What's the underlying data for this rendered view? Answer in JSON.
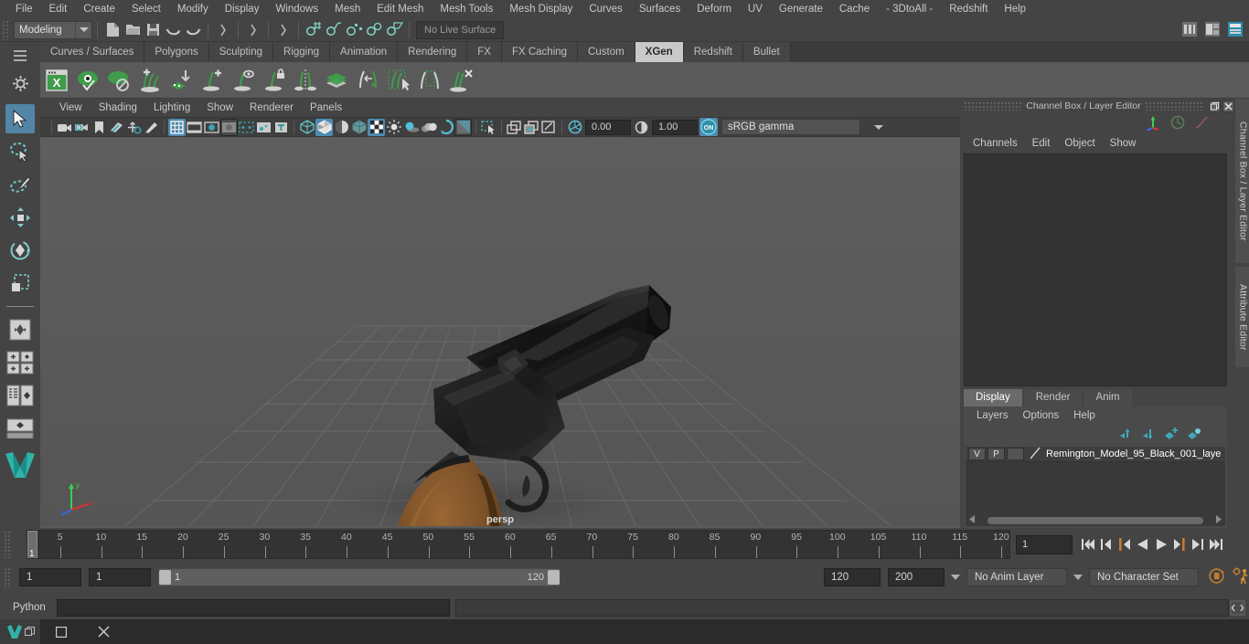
{
  "app": {
    "menubar": [
      "File",
      "Edit",
      "Create",
      "Select",
      "Modify",
      "Display",
      "Windows",
      "Mesh",
      "Edit Mesh",
      "Mesh Tools",
      "Mesh Display",
      "Curves",
      "Surfaces",
      "Deform",
      "UV",
      "Generate",
      "Cache",
      "- 3DtoAll -",
      "Redshift",
      "Help"
    ]
  },
  "statusline": {
    "mode": "Modeling",
    "live_surface": "No Live Surface"
  },
  "shelf": {
    "tabs": [
      "Curves / Surfaces",
      "Polygons",
      "Sculpting",
      "Rigging",
      "Animation",
      "Rendering",
      "FX",
      "FX Caching",
      "Custom",
      "XGen",
      "Redshift",
      "Bullet"
    ],
    "active_tab": "XGen",
    "icons": [
      "xgen-window-icon",
      "xgen-preview-icon",
      "xgen-disable-preview-icon",
      "xgen-create-description-icon",
      "xgen-import-collection-icon",
      "xgen-add-guide-icon",
      "xgen-select-guide-icon",
      "xgen-lock-guide-icon",
      "xgen-mirror-guide-icon",
      "xgen-density-mask-icon",
      "xgen-move-guide-icon",
      "xgen-guide-select-icon",
      "xgen-region-icon",
      "xgen-delete-guide-icon"
    ]
  },
  "toolbox": {
    "items": [
      "select-tool",
      "lasso-select-tool",
      "paint-select-tool",
      "move-tool",
      "rotate-tool",
      "scale-tool",
      "last-tool-used",
      "snap-grid-icon",
      "snap-curve-icon",
      "snap-point-icon",
      "snap-view-plane-icon",
      "outliner-layout-icon",
      "persp-layout-icon",
      "single-perspective-icon",
      "maya-logo-icon"
    ],
    "selected": "select-tool"
  },
  "viewport": {
    "menu": [
      "View",
      "Shading",
      "Lighting",
      "Show",
      "Renderer",
      "Panels"
    ],
    "toolbar": {
      "exposure": "0.00",
      "gamma_value": "1.00",
      "color_management": "sRGB gamma",
      "color_mgmt_toggle": "ON",
      "icons": [
        "select-camera-icon",
        "camera-attributes-icon",
        "bookmark-icon",
        "image-plane-icon",
        "two-d-pan-zoom-icon",
        "grease-pencil-icon",
        "grid-toggle-icon",
        "film-gate-icon",
        "resolution-gate-icon",
        "gate-mask-icon",
        "film-origin-icon",
        "exposure-icon",
        "safe-title-icon",
        "wireframe-icon",
        "smooth-shade-all-icon",
        "shaded-wireframe-icon",
        "textured-icon",
        "use-all-lights-icon",
        "shadows-icon",
        "screen-space-ao-icon",
        "motion-blur-icon",
        "multisample-icon",
        "depth-of-field-icon",
        "isolate-select-icon",
        "xray-icon",
        "xray-joints-icon",
        "xray-active-components-icon",
        "viewport-exposure-icon",
        "gamma-icon"
      ]
    },
    "camera_label": "persp",
    "scene_object": "Remington Model 95 Derringer pistol"
  },
  "channel_box": {
    "title": "Channel Box / Layer Editor",
    "menu": [
      "Channels",
      "Edit",
      "Object",
      "Show"
    ],
    "content": ""
  },
  "layer_editor": {
    "tabs": [
      "Display",
      "Render",
      "Anim"
    ],
    "active_tab": "Display",
    "menu": [
      "Layers",
      "Options",
      "Help"
    ],
    "buttons": [
      "move-layer-up-icon",
      "move-layer-down-icon",
      "new-layer-icon",
      "new-layer-from-selected-icon"
    ],
    "layers": [
      {
        "visibility": "V",
        "playback": "P",
        "color_swatch": "",
        "name": "Remington_Model_95_Black_001_laye"
      }
    ]
  },
  "vertical_tabs": [
    "Channel Box / Layer Editor",
    "Attribute Editor"
  ],
  "timeline": {
    "ticks": [
      5,
      10,
      15,
      20,
      25,
      30,
      35,
      40,
      45,
      50,
      55,
      60,
      65,
      70,
      75,
      80,
      85,
      90,
      95,
      100,
      105,
      110,
      115,
      120
    ],
    "current_frame_marker": "1",
    "current_frame_field": "1",
    "playback_buttons": [
      "go-to-start-icon",
      "step-back-keyframe-icon",
      "step-back-frame-icon",
      "play-backwards-icon",
      "play-forwards-icon",
      "step-forward-frame-icon",
      "step-forward-keyframe-icon",
      "go-to-end-icon"
    ]
  },
  "range": {
    "anim_start": "1",
    "playback_start": "1",
    "bar_start_label": "1",
    "bar_end_label": "120",
    "playback_end": "120",
    "anim_end": "200",
    "anim_layer": "No Anim Layer",
    "character_set": "No Character Set",
    "auto_key_icon": "auto-keyframe-icon",
    "anim_prefs_icon": "animation-preferences-icon"
  },
  "command_line": {
    "language": "Python",
    "input_value": "",
    "result_value": "",
    "script_editor_icon": "script-editor-icon"
  },
  "taskbar": {
    "buttons": [
      "app-icon",
      "maximize-icon",
      "close-icon"
    ]
  },
  "colors": {
    "accent_blue": "#4d8bb0",
    "shelf_green": "#3f9c4a",
    "panel_bg": "#444444",
    "viewport_bg": "#5a5a5a",
    "orange": "#d08030"
  }
}
